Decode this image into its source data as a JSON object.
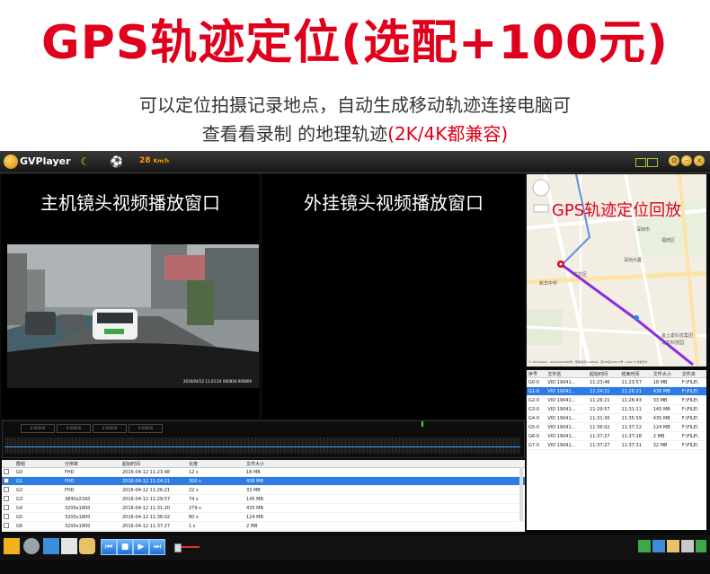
{
  "headline": "GPS轨迹定位(选配+100元)",
  "subtitle_line1": "可以定位拍摄记录地点，自动生成移动轨迹连接电脑可",
  "subtitle_line2_main": "查看看录制 的地理轨迹",
  "subtitle_line2_highlight": "(2K/4K都兼容)",
  "app": {
    "name": "GVPlayer",
    "speed_value": "28",
    "speed_unit": "Km/h"
  },
  "panels": {
    "front_label": "主机镜头视频播放窗口",
    "rear_label": "外挂镜头视频播放窗口",
    "map_label": "GPS轨迹定位回放"
  },
  "video": {
    "timestamp": "2016/04/12 11:23:24",
    "counter": "000836-000809",
    "plate": "粤B·3A09"
  },
  "timeline": [
    "0:00000",
    "0:00000",
    "0:00000",
    "0:00000"
  ],
  "file_table": {
    "headers": [
      "群组",
      "分辨率",
      "起始时间",
      "长度",
      "文件大小"
    ],
    "rows": [
      {
        "id": "G0",
        "res": "FHD",
        "start": "2016-04-12 11:23:48",
        "len": "12 s",
        "size": "18 MB",
        "selected": false
      },
      {
        "id": "G1",
        "res": "FHD",
        "start": "2016-04-12 11:24:21",
        "len": "300 s",
        "size": "436 MB",
        "selected": true
      },
      {
        "id": "G2",
        "res": "FHD",
        "start": "2016-04-12 11:26:21",
        "len": "22 s",
        "size": "33 MB",
        "selected": false
      },
      {
        "id": "G3",
        "res": "3840x2160",
        "start": "2016-04-12 11:29:57",
        "len": "74 s",
        "size": "145 MB",
        "selected": false
      },
      {
        "id": "G4",
        "res": "3200x1800",
        "start": "2016-04-12 11:31:20",
        "len": "279 s",
        "size": "435 MB",
        "selected": false
      },
      {
        "id": "G5",
        "res": "3200x1800",
        "start": "2016-04-12 11:36:02",
        "len": "80 s",
        "size": "124 MB",
        "selected": false
      },
      {
        "id": "G6",
        "res": "3200x1800",
        "start": "2016-04-12 11:37:27",
        "len": "1 s",
        "size": "2 MB",
        "selected": false
      }
    ]
  },
  "gps_table": {
    "headers": [
      "序号",
      "文件名",
      "起始时间",
      "结束时间",
      "文件大小",
      "文件夹"
    ],
    "rows": [
      {
        "id": "G0-0",
        "file": "VID 19041...",
        "start": "11:23:46",
        "end": "11:23:57",
        "size": "18 MB",
        "folder": "F:\\FILE\\"
      },
      {
        "id": "G1-0",
        "file": "VID 19041...",
        "start": "11:24:21",
        "end": "11:26:21",
        "size": "436 MB",
        "folder": "F:\\FILE\\",
        "selected": true
      },
      {
        "id": "G2-0",
        "file": "VID 19041...",
        "start": "11:26:21",
        "end": "11:26:43",
        "size": "33 MB",
        "folder": "F:\\FILE\\"
      },
      {
        "id": "G3-0",
        "file": "VID 19041...",
        "start": "11:29:57",
        "end": "11:31:11",
        "size": "145 MB",
        "folder": "F:\\FILE\\"
      },
      {
        "id": "G4-0",
        "file": "VID 19041...",
        "start": "11:31:30",
        "end": "11:35:59",
        "size": "435 MB",
        "folder": "F:\\FILE\\"
      },
      {
        "id": "G5-0",
        "file": "VID 19041...",
        "start": "11:36:02",
        "end": "11:37:22",
        "size": "124 MB",
        "folder": "F:\\FILE\\"
      },
      {
        "id": "G6-0",
        "file": "VID 19041...",
        "start": "11:37:27",
        "end": "11:37:28",
        "size": "2 MB",
        "folder": "F:\\FILE\\"
      },
      {
        "id": "G7-0",
        "file": "VID 19041...",
        "start": "11:37:27",
        "end": "11:37:31",
        "size": "32 MB",
        "folder": "F:\\FILE\\"
      }
    ]
  },
  "map": {
    "places": [
      "深圳市",
      "福田区",
      "龙华区",
      "新华中学",
      "深圳大厦",
      "富士康科技集团",
      "龙华科技园"
    ],
    "copyright": "© 2016 Baidu - GS(2016)2089号 - 甲测资字1100930 - 京ICP证030173号 - Data © 长地万方"
  },
  "colors": {
    "headline": "#e0001b",
    "selection": "#2d7be5",
    "route": "#8b2be2"
  }
}
